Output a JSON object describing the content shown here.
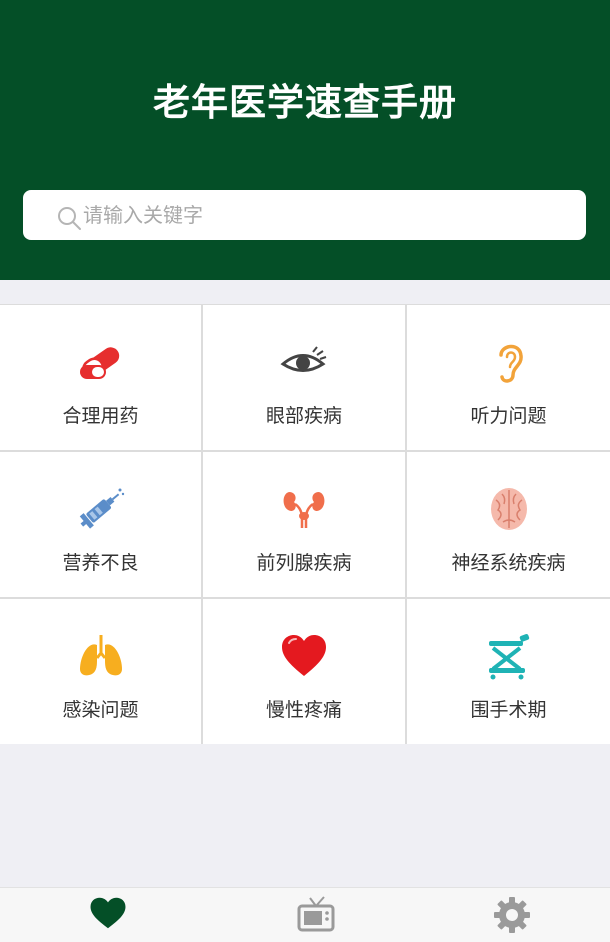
{
  "header": {
    "title": "老年医学速查手册",
    "background_color": "#044f27"
  },
  "search": {
    "placeholder": "请输入关键字",
    "icon": "search-icon"
  },
  "categories": [
    {
      "label": "合理用药",
      "icon": "pill-capsule-icon"
    },
    {
      "label": "眼部疾病",
      "icon": "eye-icon"
    },
    {
      "label": "听力问题",
      "icon": "ear-icon"
    },
    {
      "label": "营养不良",
      "icon": "syringe-icon"
    },
    {
      "label": "前列腺疾病",
      "icon": "kidney-icon"
    },
    {
      "label": "神经系统疾病",
      "icon": "brain-icon"
    },
    {
      "label": "感染问题",
      "icon": "lungs-icon"
    },
    {
      "label": "慢性疼痛",
      "icon": "heart-icon"
    },
    {
      "label": "围手术期",
      "icon": "stretcher-icon"
    }
  ],
  "tabbar": {
    "tabs": [
      {
        "icon": "heart-icon",
        "active": true,
        "color": "#044f27"
      },
      {
        "icon": "tv-icon",
        "active": false,
        "color": "#9a9a9a"
      },
      {
        "icon": "gear-icon",
        "active": false,
        "color": "#9a9a9a"
      }
    ]
  }
}
